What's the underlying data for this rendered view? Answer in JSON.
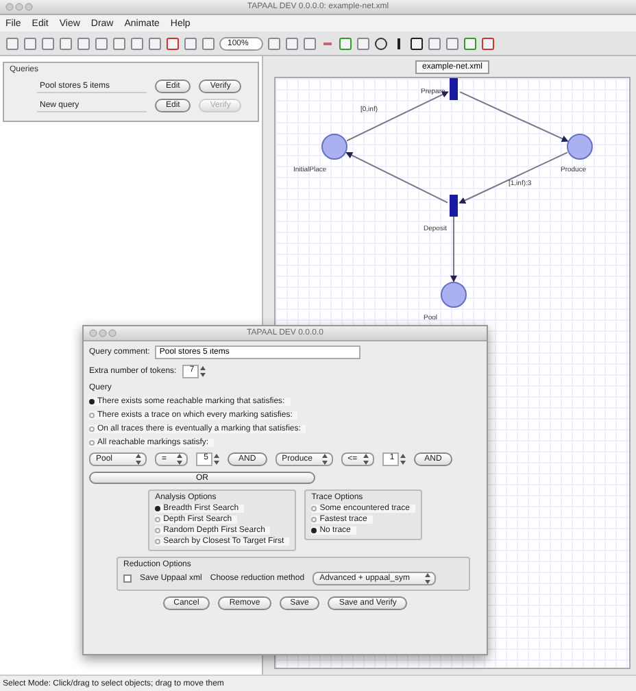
{
  "window": {
    "title": "TAPAAL DEV 0.0.0.0: example-net.xml"
  },
  "menu": [
    "File",
    "Edit",
    "View",
    "Draw",
    "Animate",
    "Help"
  ],
  "toolbar": {
    "zoom": "100%"
  },
  "queries": {
    "title": "Queries",
    "items": [
      {
        "name": "Pool stores 5 items",
        "edit": "Edit",
        "verify": "Verify",
        "verify_disabled": false
      },
      {
        "name": "New query",
        "edit": "Edit",
        "verify": "Verify",
        "verify_disabled": true
      }
    ]
  },
  "editor": {
    "tab": "example-net.xml",
    "nodes": [
      {
        "kind": "transition",
        "label": "Prepare"
      },
      {
        "kind": "place",
        "label": "InitialPlace"
      },
      {
        "kind": "place",
        "label": "Produce"
      },
      {
        "kind": "transition",
        "label": "Deposit"
      },
      {
        "kind": "place",
        "label": "Pool"
      }
    ],
    "arc_labels": [
      "[0,inf)",
      "[1,inf):3"
    ]
  },
  "dialog": {
    "title": "TAPAAL DEV 0.0.0.0",
    "comment_label": "Query comment:",
    "comment_value": "Pool stores 5 items",
    "tokens_label": "Extra number of tokens:",
    "tokens_value": "7",
    "query_title": "Query",
    "quantifiers": [
      {
        "label": "There exists some reachable marking that satisfies:",
        "selected": true
      },
      {
        "label": "There exists a trace on which every marking satisfies:",
        "selected": false
      },
      {
        "label": "On all traces there is eventually a marking that satisfies:",
        "selected": false
      },
      {
        "label": "All reachable markings satisfy:",
        "selected": false
      }
    ],
    "predicates": [
      {
        "place": "Pool",
        "op": "=",
        "value": "5",
        "join": "AND"
      },
      {
        "place": "Produce",
        "op": "<=",
        "value": "1",
        "join": "AND"
      }
    ],
    "or": "OR",
    "analysis_title": "Analysis Options",
    "analysis": [
      {
        "label": "Breadth First Search",
        "selected": true
      },
      {
        "label": "Depth First Search",
        "selected": false
      },
      {
        "label": "Random Depth First Search",
        "selected": false
      },
      {
        "label": "Search by Closest To Target First",
        "selected": false
      }
    ],
    "trace_title": "Trace Options",
    "trace": [
      {
        "label": "Some encountered trace",
        "selected": false
      },
      {
        "label": "Fastest trace",
        "selected": false
      },
      {
        "label": "No trace",
        "selected": true
      }
    ],
    "reduction_title": "Reduction Options",
    "save_uppaal": {
      "label": "Save Uppaal xml",
      "checked": false
    },
    "method_label": "Choose reduction method",
    "method_value": "Advanced + uppaal_sym",
    "buttons": [
      "Cancel",
      "Remove",
      "Save",
      "Save and Verify"
    ]
  },
  "status_bar": "Select Mode: Click/drag to select objects; drag to move them"
}
